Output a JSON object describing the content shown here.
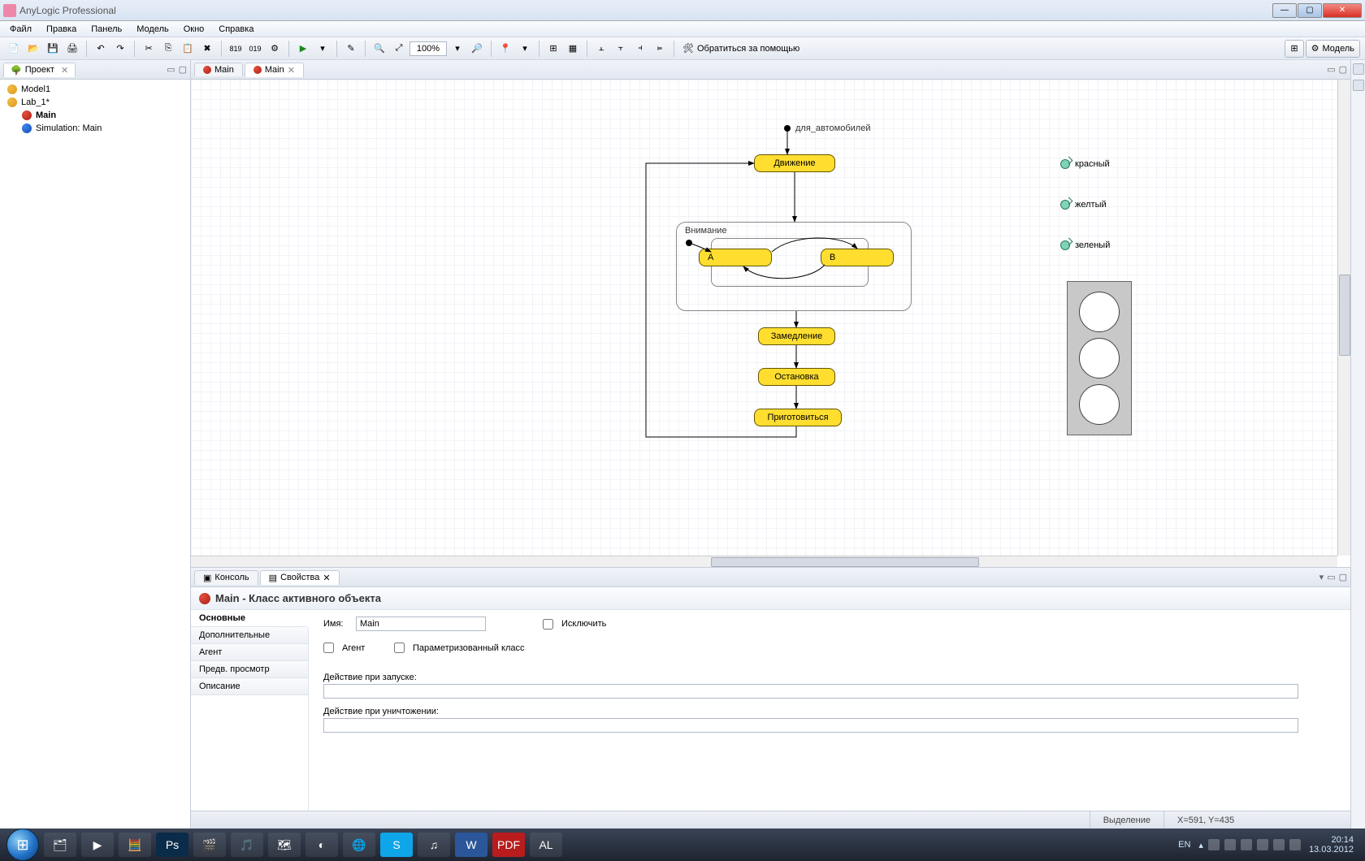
{
  "window": {
    "title": "AnyLogic Professional"
  },
  "menu": {
    "items": [
      "Файл",
      "Правка",
      "Панель",
      "Модель",
      "Окно",
      "Справка"
    ]
  },
  "toolbar": {
    "zoom": "100%",
    "help": "Обратиться за помощью",
    "open_perspective": "Модель"
  },
  "project_panel": {
    "title": "Проект",
    "items": [
      {
        "label": "Model1",
        "depth": 0,
        "icon": "model"
      },
      {
        "label": "Lab_1*",
        "depth": 0,
        "icon": "model"
      },
      {
        "label": "Main",
        "depth": 1,
        "icon": "agent",
        "bold": true
      },
      {
        "label": "Simulation: Main",
        "depth": 1,
        "icon": "sim"
      }
    ]
  },
  "editor": {
    "tabs": [
      {
        "label": "Main",
        "active": false
      },
      {
        "label": "Main",
        "active": true
      }
    ]
  },
  "canvas": {
    "statechart_entry_label": "для_автомобилей",
    "states": {
      "movement": "Движение",
      "attention": "Внимание",
      "a": "A",
      "b": "B",
      "slowdown": "Замедление",
      "stop": "Остановка",
      "prepare": "Приготовиться"
    },
    "events": [
      {
        "label": "красный"
      },
      {
        "label": "желтый"
      },
      {
        "label": "зеленый"
      }
    ]
  },
  "bottom_panel": {
    "tabs": {
      "console": "Консоль",
      "properties": "Свойства"
    },
    "header": "Main - Класс активного объекта",
    "categories": [
      "Основные",
      "Дополнительные",
      "Агент",
      "Предв. просмотр",
      "Описание"
    ],
    "form": {
      "name_label": "Имя:",
      "name_value": "Main",
      "exclude_label": "Исключить",
      "agent_label": "Агент",
      "param_class_label": "Параметризованный класс",
      "on_start_label": "Действие при запуске:",
      "on_start_value": "",
      "on_destroy_label": "Действие при уничтожении:",
      "on_destroy_value": ""
    }
  },
  "statusbar": {
    "mode": "Выделение",
    "coords": "X=591, Y=435"
  },
  "taskbar": {
    "lang": "EN",
    "clock_time": "20:14",
    "clock_date": "13.03.2012"
  }
}
